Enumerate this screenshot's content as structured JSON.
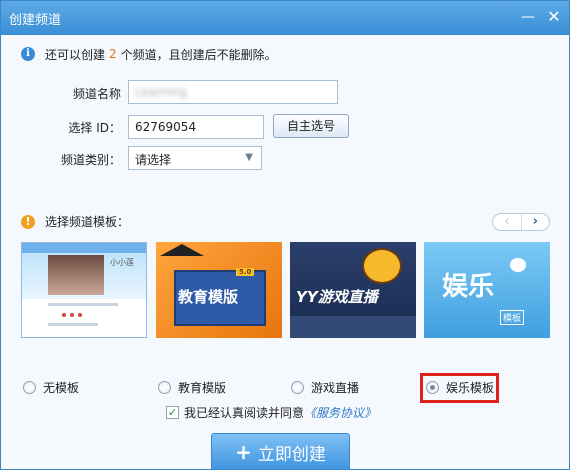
{
  "window": {
    "title": "创建频道",
    "minimize_glyph": "—",
    "close_glyph": "✕"
  },
  "info": {
    "icon": "info-icon",
    "prefix": "还可以创建",
    "count": "2",
    "suffix": "个频道，且创建后不能删除。"
  },
  "form": {
    "name_label": "频道名称",
    "name_value": "Learning",
    "id_label": "选择 ID：",
    "id_value": "62769054",
    "pick_button": "自主选号",
    "type_label": "频道类别：",
    "type_value": "请选择"
  },
  "templates": {
    "heading": "选择频道模板：",
    "pager_prev": "‹",
    "pager_next": "›",
    "items": [
      {
        "label": "无模板",
        "thumb_text": "小小莲",
        "selected": false
      },
      {
        "label": "教育模版",
        "thumb_text": "教育模版",
        "badge": "5.0",
        "selected": false
      },
      {
        "label": "游戏直播",
        "thumb_text": "YY游戏直播",
        "selected": false
      },
      {
        "label": "娱乐模板",
        "thumb_text": "娱乐",
        "tag": "模板",
        "selected": true
      }
    ]
  },
  "agreement": {
    "checked": true,
    "text": "我已经认真阅读并同意",
    "link": "《服务协议》"
  },
  "create_button": "立即创建",
  "colors": {
    "titlebar": "#3a8fd6",
    "accent": "#3f95e0",
    "highlight": "#e0201a",
    "count": "#e07a12"
  }
}
